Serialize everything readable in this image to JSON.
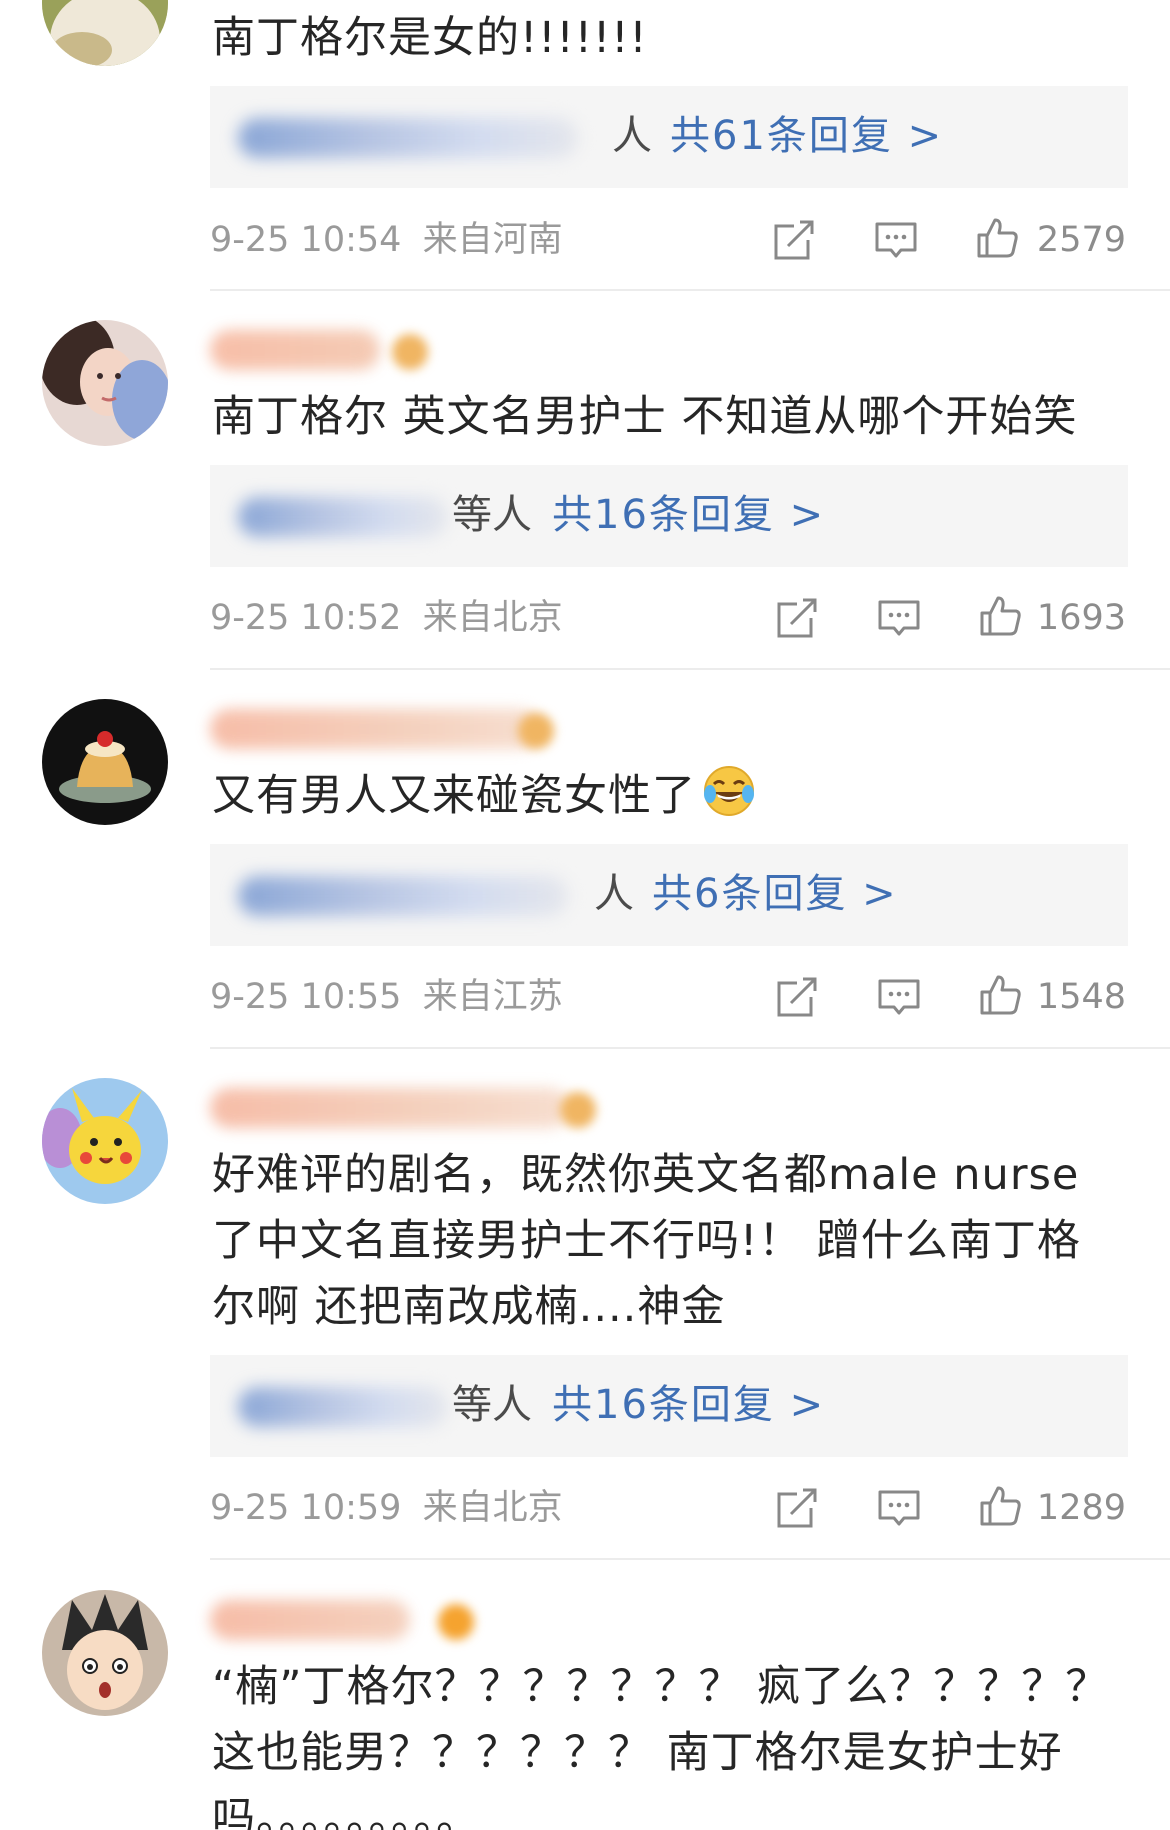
{
  "comments": [
    {
      "text": "南丁格尔是女的!!!!!!!",
      "reply_suffix": "人",
      "reply_total": "共61条回复 >",
      "time": "9-25 10:54",
      "location": "来自河南",
      "likes": "2579"
    },
    {
      "text": "南丁格尔 英文名男护士 不知道从哪个开始笑",
      "reply_suffix": "等人",
      "reply_total": "共16条回复 >",
      "time": "9-25 10:52",
      "location": "来自北京",
      "likes": "1693"
    },
    {
      "text": "又有男人又来碰瓷女性了",
      "emoji": "laugh-cry-emoji",
      "reply_suffix": "人",
      "reply_total": "共6条回复 >",
      "time": "9-25 10:55",
      "location": "来自江苏",
      "likes": "1548"
    },
    {
      "text": "好难评的剧名，既然你英文名都male nurse了中文名直接男护士不行吗!！ 蹭什么南丁格尔啊 还把南改成楠....神金",
      "reply_suffix": "等人",
      "reply_total": "共16条回复 >",
      "time": "9-25 10:59",
      "location": "来自北京",
      "likes": "1289"
    },
    {
      "text": "“楠”丁格尔？？？？？？？ 疯了么？？？？？ 这也能男？？？？？？ 南丁格尔是女护士好吗。。。。。。。。。"
    }
  ],
  "icons": {
    "share": "share-icon",
    "comment": "comment-icon",
    "like": "thumbs-up-icon"
  },
  "colors": {
    "link_blue": "#3f6fb4",
    "meta_gray": "#9a9a9a",
    "reply_bg": "#f5f5f5"
  }
}
